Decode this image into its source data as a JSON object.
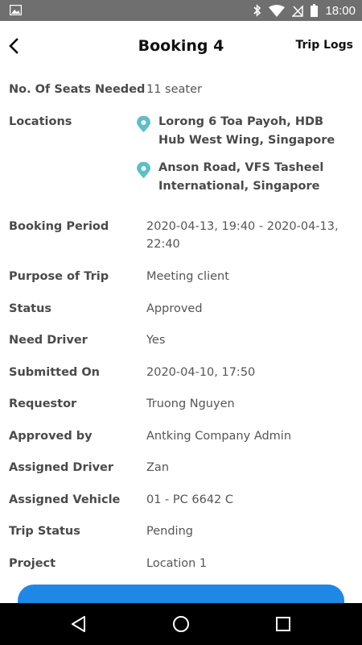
{
  "status_bar": {
    "time": "18:00",
    "icons": [
      "image-icon",
      "bluetooth-icon",
      "wifi-icon",
      "no-signal-icon",
      "battery-icon"
    ]
  },
  "header": {
    "title": "Booking 4",
    "trip_logs_label": "Trip Logs"
  },
  "details": {
    "seats": {
      "label": "No. Of Seats Needed",
      "value": "11 seater"
    },
    "locations": {
      "label": "Locations",
      "items": [
        "Lorong 6 Toa Payoh, HDB Hub West Wing, Singapore",
        "Anson Road, VFS Tasheel International, Singapore"
      ]
    },
    "booking_period": {
      "label": "Booking Period",
      "value": "2020-04-13, 19:40 - 2020-04-13, 22:40"
    },
    "purpose": {
      "label": "Purpose of Trip",
      "value": "Meeting client"
    },
    "status": {
      "label": "Status",
      "value": "Approved"
    },
    "need_driver": {
      "label": "Need Driver",
      "value": "Yes"
    },
    "submitted_on": {
      "label": "Submitted On",
      "value": "2020-04-10, 17:50"
    },
    "requestor": {
      "label": "Requestor",
      "value": "Truong Nguyen"
    },
    "approved_by": {
      "label": "Approved by",
      "value": "Antking Company Admin"
    },
    "assigned_driver": {
      "label": "Assigned Driver",
      "value": "Zan"
    },
    "assigned_vehicle": {
      "label": "Assigned Vehicle",
      "value": "01 - PC 6642 C"
    },
    "trip_status": {
      "label": "Trip Status",
      "value": "Pending"
    },
    "project": {
      "label": "Project",
      "value": "Location 1"
    }
  },
  "colors": {
    "pin": "#5bc0c8",
    "primary_button": "#1f87e6",
    "status_bar": "#6f6f6f",
    "nav_bar": "#000000"
  },
  "nav_bar": {
    "icons": [
      "back-triangle-icon",
      "home-circle-icon",
      "recents-square-icon"
    ]
  }
}
